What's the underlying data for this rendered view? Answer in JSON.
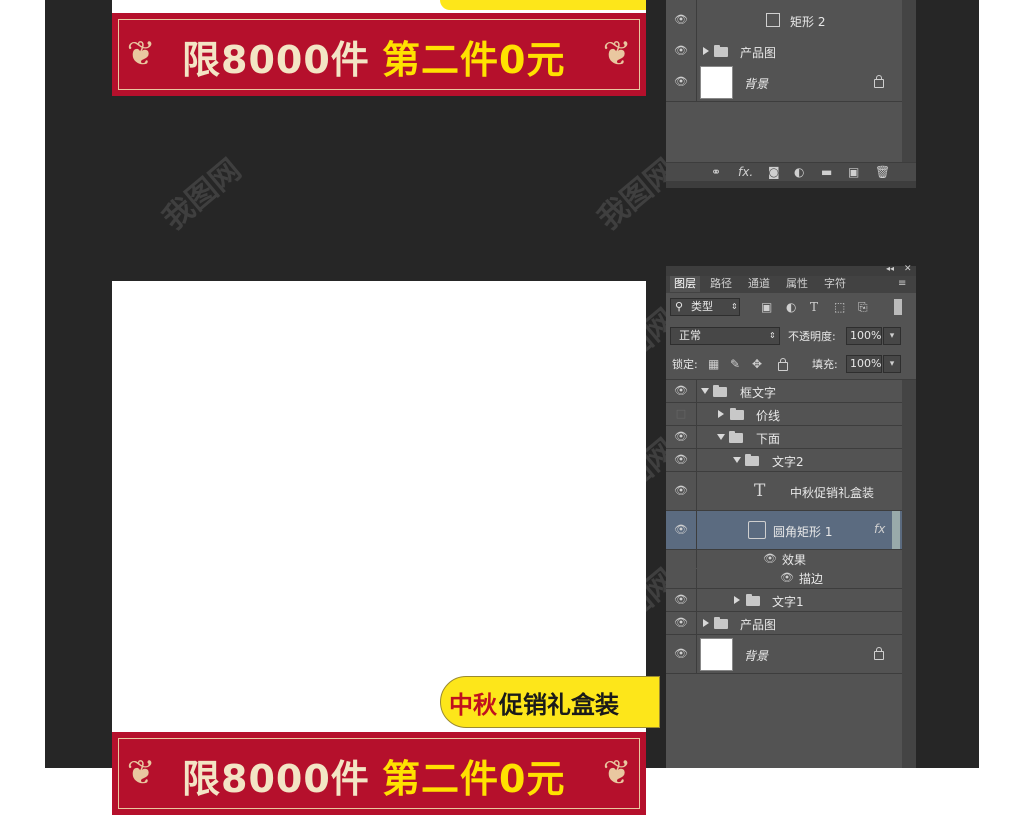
{
  "banner": {
    "text_limit": "限8000件",
    "text_offer": "第二件0元"
  },
  "promo_label": {
    "part1": "中秋",
    "part2": "促销礼盒装"
  },
  "watermark": "我图网",
  "top_panel": {
    "layers": [
      {
        "name": "矩形 2"
      },
      {
        "name": "产品图"
      },
      {
        "name": "背景"
      }
    ],
    "footer_icons": [
      "link-icon",
      "fx-icon",
      "mask-icon",
      "adjustment-icon",
      "folder-icon",
      "new-layer-icon",
      "trash-icon"
    ]
  },
  "layers_panel": {
    "tabs": [
      "图层",
      "路径",
      "通道",
      "属性",
      "字符"
    ],
    "filter_label": "类型",
    "blend_mode": "正常",
    "opacity_label": "不透明度:",
    "opacity_value": "100%",
    "lock_label": "锁定:",
    "fill_label": "填充:",
    "fill_value": "100%",
    "layers": [
      {
        "name": "框文字"
      },
      {
        "name": "价线"
      },
      {
        "name": "下面"
      },
      {
        "name": "文字2"
      },
      {
        "name": "中秋促销礼盒装"
      },
      {
        "name": "圆角矩形 1"
      },
      {
        "name": "效果"
      },
      {
        "name": "描边"
      },
      {
        "name": "文字1"
      },
      {
        "name": "产品图"
      },
      {
        "name": "背景"
      }
    ],
    "fx_badge": "fx",
    "text_icon_glyph": "T"
  }
}
